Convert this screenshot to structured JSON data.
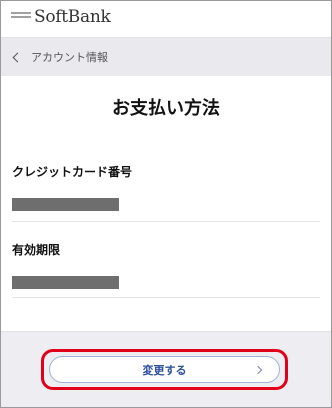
{
  "header": {
    "brand": "SoftBank"
  },
  "breadcrumb": {
    "label": "アカウント情報"
  },
  "page": {
    "title": "お支払い方法"
  },
  "sections": [
    {
      "label": "クレジットカード番号",
      "value_masked": true
    },
    {
      "label": "有効期限",
      "value_masked": true
    }
  ],
  "footer": {
    "change_button_label": "変更する"
  },
  "colors": {
    "highlight": "#e0001a",
    "button_text": "#2d4f9e",
    "background_gray": "#e9e9ee"
  },
  "icons": {
    "back": "chevron-left-icon",
    "forward": "chevron-right-icon",
    "logo": "softbank-logo-icon"
  }
}
